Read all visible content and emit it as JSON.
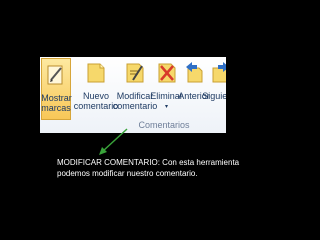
{
  "ribbon": {
    "buttons": {
      "show_markup": {
        "line1": "Mostrar",
        "line2": "marcas",
        "icon": "pen-markup-icon"
      },
      "new_comment": {
        "line1": "Nuevo",
        "line2": "comentario",
        "icon": "note-icon"
      },
      "edit_comment": {
        "line1": "Modificar",
        "line2": "comentario",
        "icon": "note-pencil-icon"
      },
      "delete": {
        "line1": "Eliminar",
        "line2": "▾",
        "icon": "note-delete-icon"
      },
      "previous": {
        "line1": "Anterior",
        "icon": "note-arrow-left-icon"
      },
      "next": {
        "line1": "Siguiente",
        "icon": "note-arrow-right-icon"
      }
    },
    "group_label": "Comentarios"
  },
  "caption": {
    "line1": "MODIFICAR COMENTARIO: Con esta herramienta",
    "line2": "podemos modificar nuestro comentario."
  },
  "colors": {
    "background": "#000000",
    "ribbon": "#ffffff",
    "label_text": "#1f3b63",
    "note_yellow": "#f6d86b",
    "pointer_green": "#39a33a",
    "caption_text": "#ffffff"
  }
}
